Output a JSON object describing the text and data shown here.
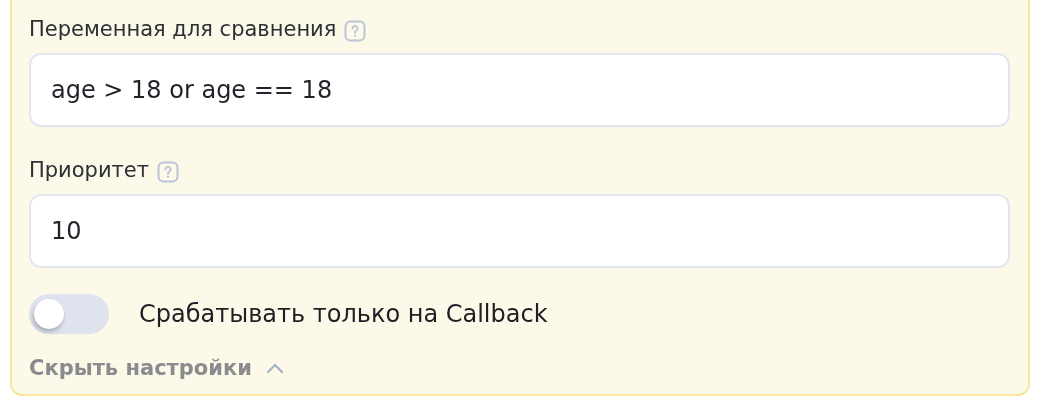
{
  "fields": [
    {
      "label": "Переменная для сравнения",
      "value": "age > 18 or age == 18"
    },
    {
      "label": "Приоритет",
      "value": "10"
    }
  ],
  "callback_toggle": {
    "label": "Срабатывать только на Callback",
    "on": false
  },
  "hide_settings_link": {
    "label": "Скрыть настройки",
    "expanded": true
  }
}
